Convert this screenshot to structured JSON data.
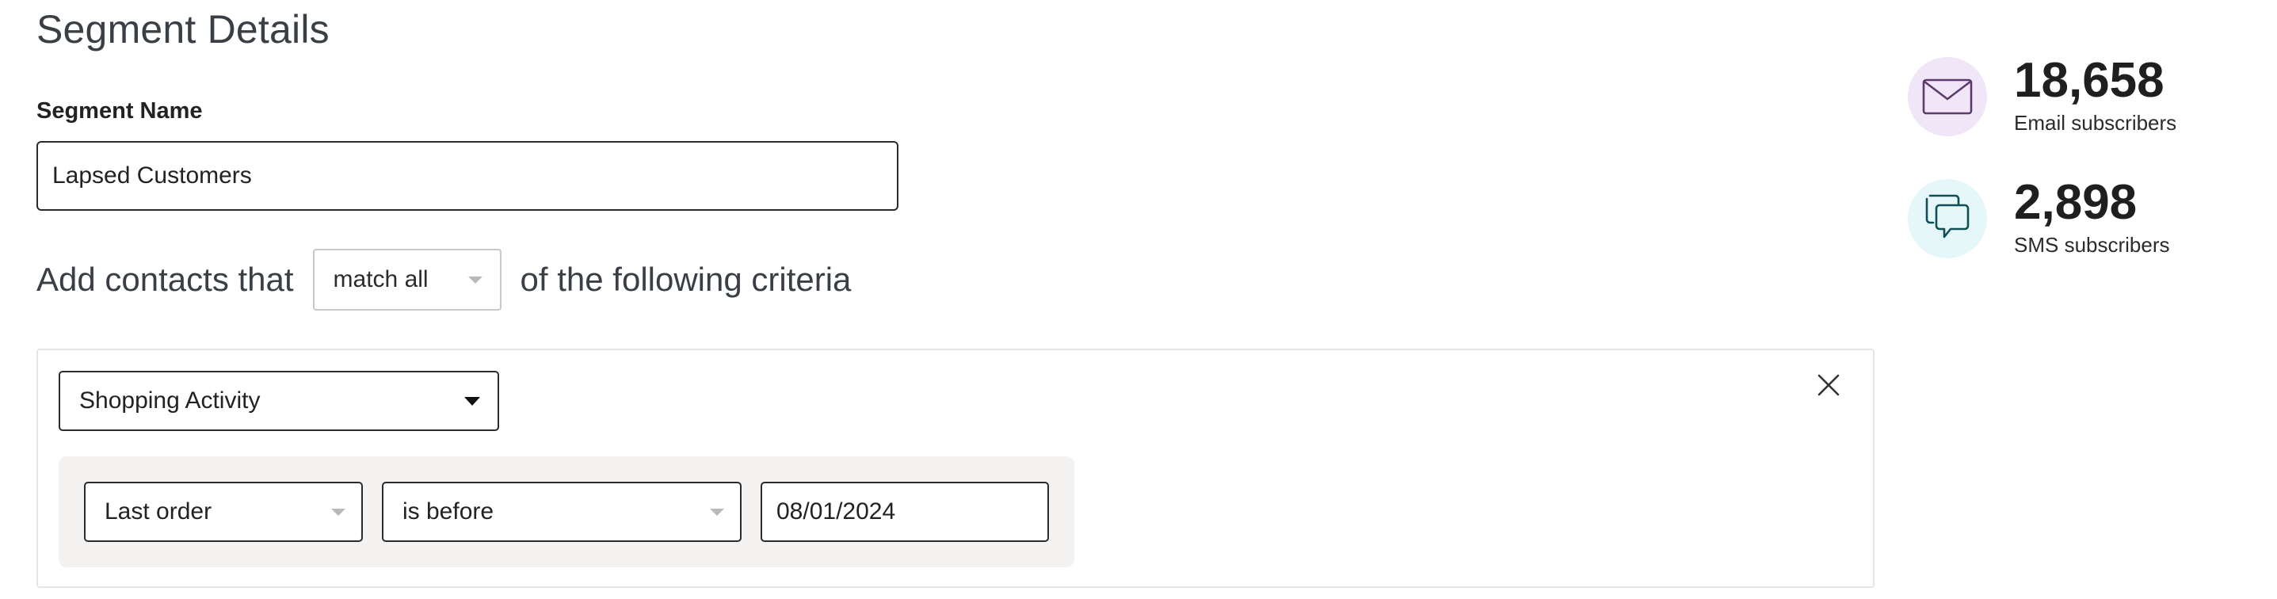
{
  "page": {
    "title": "Segment Details"
  },
  "segment_name": {
    "label": "Segment Name",
    "value": "Lapsed Customers"
  },
  "criteria_header": {
    "prefix": "Add contacts that",
    "match_mode": "match all",
    "suffix": "of the following criteria"
  },
  "condition_group": {
    "category": "Shopping Activity",
    "rule": {
      "field": "Last order",
      "operator": "is before",
      "date_value": "08/01/2024"
    },
    "remove_icon": "close-icon"
  },
  "stats": {
    "email": {
      "count": "18,658",
      "label": "Email subscribers",
      "icon": "envelope-icon",
      "icon_color": "#5b3b6e",
      "icon_bg": "#f1e6f8"
    },
    "sms": {
      "count": "2,898",
      "label": "SMS subscribers",
      "icon": "chat-bubbles-icon",
      "icon_color": "#0f4f57",
      "icon_bg": "#e5f7f8"
    }
  }
}
